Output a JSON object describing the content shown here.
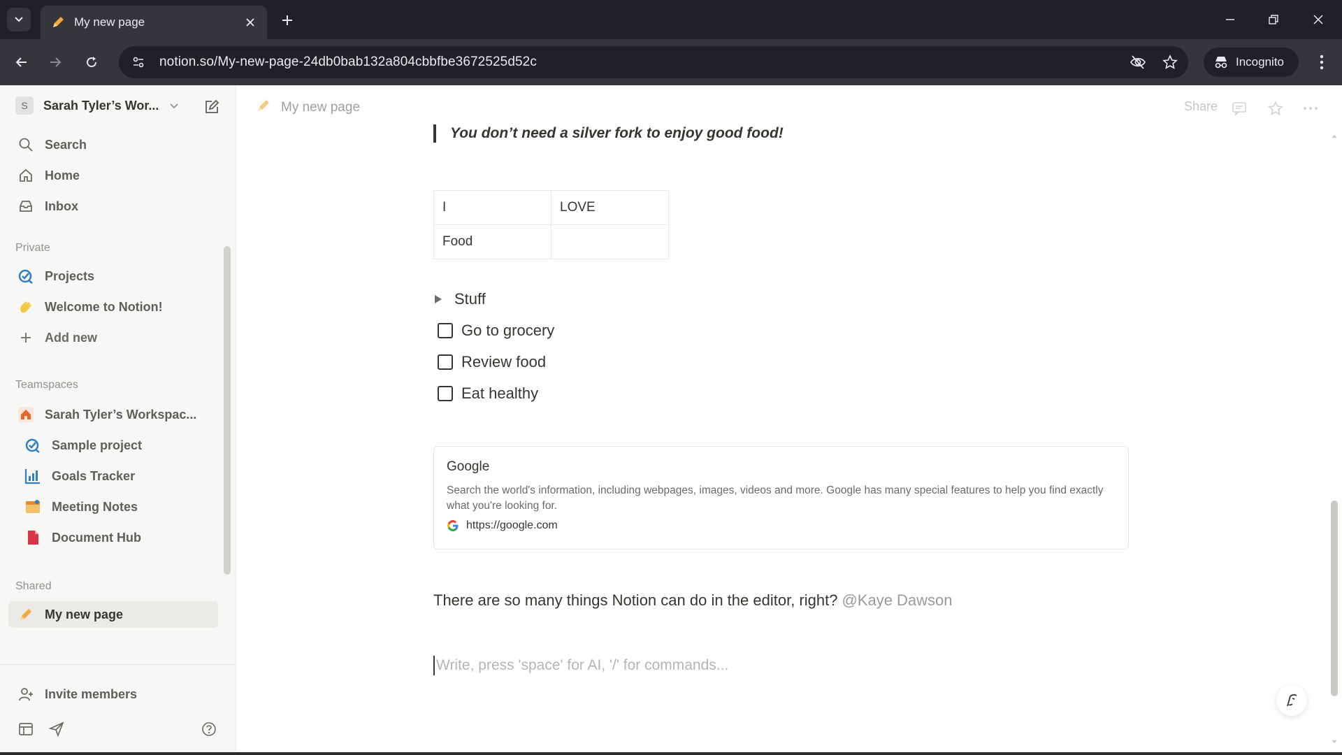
{
  "browser": {
    "tab_title": "My new page",
    "url": "notion.so/My-new-page-24db0bab132a804cbbfbe3672525d52c",
    "incognito_label": "Incognito"
  },
  "sidebar": {
    "workspace_initial": "S",
    "workspace_name": "Sarah Tyler’s Wor...",
    "top_items": [
      {
        "label": "Search",
        "icon": "search-icon"
      },
      {
        "label": "Home",
        "icon": "home-icon"
      },
      {
        "label": "Inbox",
        "icon": "inbox-icon"
      }
    ],
    "private_heading": "Private",
    "private_items": [
      {
        "label": "Projects",
        "icon": "projects-icon"
      },
      {
        "label": "Welcome to Notion!",
        "icon": "wave-hand-icon"
      },
      {
        "label": "Add new",
        "icon": "plus-icon"
      }
    ],
    "teamspaces_heading": "Teamspaces",
    "teamspace_name": "Sarah Tyler’s Workspac...",
    "teamspace_items": [
      {
        "label": "Sample project",
        "icon": "projects-icon"
      },
      {
        "label": "Goals Tracker",
        "icon": "chart-icon"
      },
      {
        "label": "Meeting Notes",
        "icon": "calendar-icon"
      },
      {
        "label": "Document Hub",
        "icon": "document-icon"
      }
    ],
    "shared_heading": "Shared",
    "shared_items": [
      {
        "label": "My new page",
        "icon": "pencil-icon"
      }
    ],
    "invite_label": "Invite members"
  },
  "page": {
    "breadcrumb": "My new page",
    "share_label": "Share",
    "quote": "You don’t need a silver fork to enjoy good food!",
    "table": [
      [
        "I",
        "LOVE"
      ],
      [
        "Food",
        ""
      ]
    ],
    "toggle_label": "Stuff",
    "todos": [
      "Go to grocery",
      "Review food",
      "Eat healthy"
    ],
    "bookmark": {
      "title": "Google",
      "description": "Search the world's information, including webpages, images, videos and more. Google has many special features to help you find exactly what you're looking for.",
      "url": "https://google.com"
    },
    "paragraph": "There are so many things Notion can do in the editor, right?",
    "mention": "@Kaye Dawson",
    "placeholder": "Write, press 'space' for AI, '/' for commands..."
  }
}
